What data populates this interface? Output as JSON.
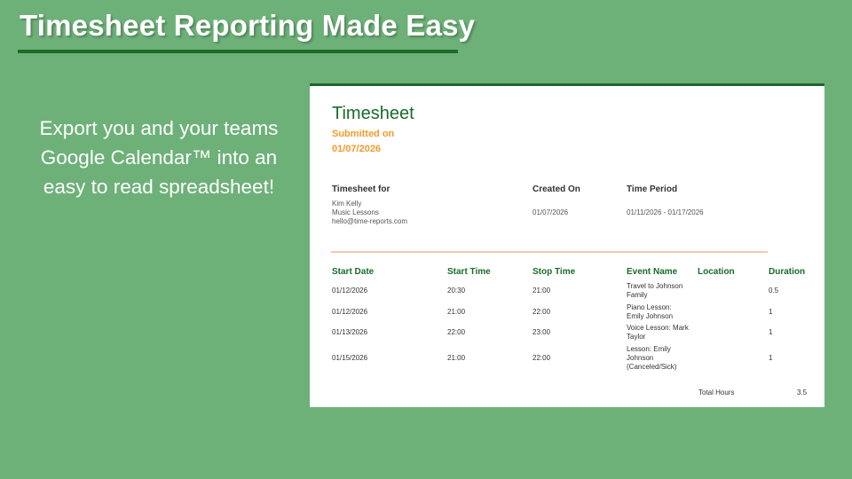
{
  "slide": {
    "title": "Timesheet Reporting Made Easy",
    "subtitle": "Export you and your teams Google Calendar™ into an easy to read spreadsheet!"
  },
  "sheet": {
    "title": "Timesheet",
    "submitted_label": "Submitted on",
    "submitted_date": "01/07/2026",
    "meta": {
      "for_label": "Timesheet for",
      "name": "Kim Kelly",
      "org": "Music Lessons",
      "email": "hello@time-reports.com",
      "created_label": "Created On",
      "created_value": "01/07/2026",
      "period_label": "Time Period",
      "period_value": "01/11/2026 - 01/17/2026"
    },
    "columns": {
      "start_date": "Start Date",
      "start_time": "Start Time",
      "stop_time": "Stop Time",
      "event_name": "Event Name",
      "location": "Location",
      "duration": "Duration"
    },
    "rows": [
      {
        "start_date": "01/12/2026",
        "start_time": "20:30",
        "stop_time": "21:00",
        "event_name": "Travel to Johnson Family",
        "location": "",
        "duration": "0.5"
      },
      {
        "start_date": "01/12/2026",
        "start_time": "21:00",
        "stop_time": "22:00",
        "event_name": "Piano Lesson: Emily Johnson",
        "location": "",
        "duration": "1"
      },
      {
        "start_date": "01/13/2026",
        "start_time": "22:00",
        "stop_time": "23:00",
        "event_name": "Voice Lesson: Mark Taylor",
        "location": "",
        "duration": "1"
      },
      {
        "start_date": "01/15/2026",
        "start_time": "21:00",
        "stop_time": "22:00",
        "event_name": "Lesson: Emily Johnson (Canceled/Sick)",
        "location": "",
        "duration": "1"
      }
    ],
    "total_label": "Total Hours",
    "total_value": "3.5"
  },
  "colors": {
    "background": "#6db178",
    "dark_green": "#1a6b2a",
    "orange": "#f59a2c",
    "divider": "#f6c8b4"
  }
}
